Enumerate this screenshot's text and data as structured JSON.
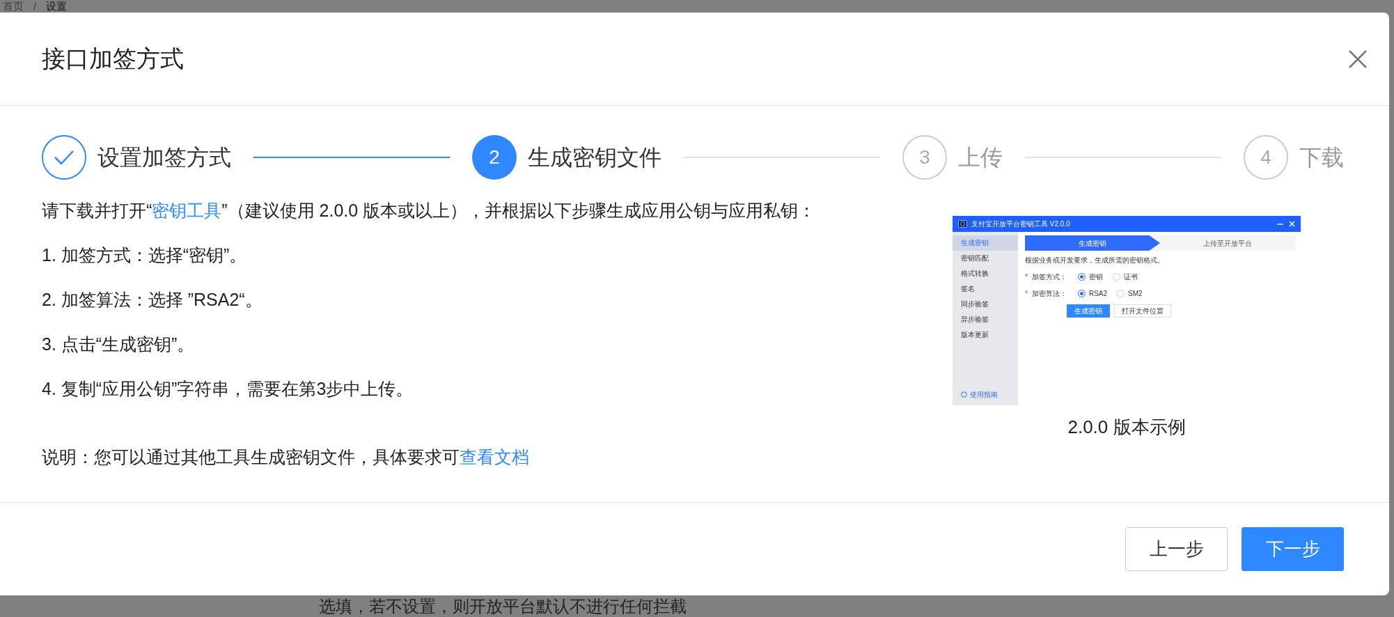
{
  "background": {
    "breadcrumb": [
      {
        "label": "首页",
        "selected": false
      },
      {
        "label": "设置",
        "selected": true
      }
    ],
    "separator": "/",
    "hint": "选填，若不设置，则开放平台默认不进行任何拦截"
  },
  "dialog": {
    "title": "接口加签方式",
    "steps": [
      {
        "completed": true,
        "selected": false,
        "label": "设置加签方式"
      },
      {
        "completed": false,
        "selected": true,
        "number": "2",
        "label": "生成密钥文件"
      },
      {
        "completed": false,
        "selected": false,
        "number": "3",
        "label": "上传"
      },
      {
        "completed": false,
        "selected": false,
        "number": "4",
        "label": "下载"
      }
    ],
    "intro": {
      "before": "请下载并打开“",
      "link": "密钥工具",
      "after": "”（建议使用 2.0.0 版本或以上），并根据以下步骤生成应用公钥与应用私钥："
    },
    "instructions": [
      "1. 加签方式：选择“密钥”。",
      "2. 加签算法：选择 ”RSA2“。",
      "3. 点击“生成密钥”。",
      "4. 复制“应用公钥”字符串，需要在第3步中上传。"
    ],
    "note": {
      "before": "说明：您可以通过其他工具生成密钥文件，具体要求可",
      "link": "查看文档"
    },
    "example": {
      "caption": "2.0.0 版本示例",
      "app": {
        "title": "支付宝开放平台密钥工具 V2.0.0",
        "sidebar": [
          {
            "label": "生成密钥",
            "selected": true
          },
          {
            "label": "密钥匹配",
            "selected": false
          },
          {
            "label": "格式转换",
            "selected": false
          },
          {
            "label": "签名",
            "selected": false
          },
          {
            "label": "同步验签",
            "selected": false
          },
          {
            "label": "异步验签",
            "selected": false
          },
          {
            "label": "版本更新",
            "selected": false
          }
        ],
        "help": "使用指南",
        "tabs": [
          {
            "label": "生成密钥",
            "selected": true
          },
          {
            "label": "上传至开放平台",
            "selected": false
          }
        ],
        "description": "根据业务或开发要求，生成所需的密钥格式。",
        "fields": [
          {
            "marker": "*",
            "label": "加签方式：",
            "options": [
              {
                "label": "密钥",
                "selected": true
              },
              {
                "label": "证书",
                "selected": false
              }
            ]
          },
          {
            "marker": "*",
            "label": "加密算法：",
            "options": [
              {
                "label": "RSA2",
                "selected": true
              },
              {
                "label": "SM2",
                "selected": false
              }
            ]
          }
        ],
        "buttons": [
          {
            "label": "生成密钥",
            "kind": "primary"
          },
          {
            "label": "打开文件位置",
            "kind": "default"
          }
        ]
      }
    },
    "buttons": [
      {
        "label": "上一步",
        "kind": "default"
      },
      {
        "label": "下一步",
        "kind": "primary"
      }
    ]
  }
}
